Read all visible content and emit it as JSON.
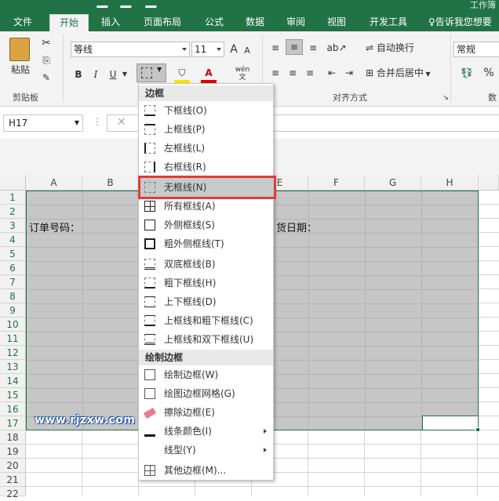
{
  "title": {
    "doc": "工作簿"
  },
  "tabs": [
    "文件",
    "开始",
    "插入",
    "页面布局",
    "公式",
    "数据",
    "审阅",
    "视图",
    "开发工具"
  ],
  "tellme": "告诉我您想要",
  "ribbon": {
    "paste": "粘贴",
    "clipboard": "剪贴板",
    "font_name": "等线",
    "font_size": "11",
    "grow": "A",
    "shrink": "A",
    "bold": "B",
    "italic": "I",
    "underline": "U",
    "phonetic": "wén",
    "wrap": "自动换行",
    "merge": "合并后居中",
    "align_group": "对齐方式",
    "number_format": "常规",
    "percent": "%",
    "number_group": "数"
  },
  "formula_bar": {
    "name_box": "H17",
    "cancel": "✕"
  },
  "columns": [
    "A",
    "B",
    "C",
    "D",
    "E",
    "F",
    "G",
    "H"
  ],
  "rows": [
    "1",
    "2",
    "3",
    "4",
    "5",
    "6",
    "7",
    "8",
    "9",
    "10",
    "11",
    "12",
    "13",
    "14",
    "15",
    "16",
    "17",
    "18",
    "19",
    "20",
    "21",
    "22"
  ],
  "cells": {
    "a3": "订单号码：",
    "e3": "货日期："
  },
  "menu": {
    "header1": "边框",
    "items1": [
      "下框线(O)",
      "上框线(P)",
      "左框线(L)",
      "右框线(R)",
      "无框线(N)",
      "所有框线(A)",
      "外侧框线(S)",
      "粗外侧框线(T)",
      "双底框线(B)",
      "粗下框线(H)",
      "上下框线(D)",
      "上框线和粗下框线(C)",
      "上框线和双下框线(U)"
    ],
    "header2": "绘制边框",
    "items2": [
      "绘制边框(W)",
      "绘图边框网格(G)",
      "擦除边框(E)",
      "线条颜色(I)",
      "线型(Y)",
      "其他边框(M)..."
    ]
  },
  "watermark": "www.rjzxw.com",
  "colors": {
    "excel_green": "#217346",
    "selection_fill": "#c6c6c6",
    "highlight_red": "#e03b3b"
  }
}
